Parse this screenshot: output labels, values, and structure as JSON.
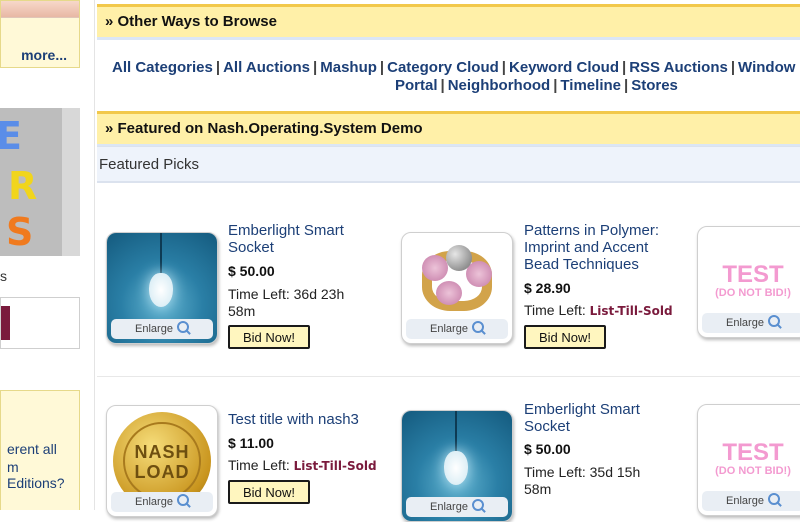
{
  "left": {
    "more_label": "more...",
    "banner_letters": [
      "E",
      "R",
      "S"
    ],
    "small_char": "s",
    "promo_lines": [
      "erent all",
      "m Editions?"
    ]
  },
  "sections": {
    "browse_title": "» Other Ways to Browse",
    "featured_title": "» Featured on Nash.Operating.System Demo",
    "picks_label": "Featured Picks"
  },
  "browse_links_row1": [
    "All Categories",
    "All Auctions",
    "Mashup",
    "Category Cloud",
    "Keyword Cloud",
    "RSS Auctions",
    "Window"
  ],
  "browse_links_row2": [
    "Portal",
    "Neighborhood",
    "Timeline",
    "Stores"
  ],
  "enlarge_label": "Enlarge",
  "bid_label": "Bid Now!",
  "time_left_label": "Time Left:",
  "listings": [
    {
      "title": "Emberlight Smart Socket",
      "price": "$ 50.00",
      "time": "36d 23h 58m"
    },
    {
      "title": "Patterns in Polymer: Imprint and Accent Bead Techniques",
      "price": "$ 28.90",
      "time": "List-Till-Sold"
    },
    {
      "title": "Test title with nash3",
      "price": "$ 11.00",
      "time": "List-Till-Sold"
    },
    {
      "title": "Emberlight Smart Socket",
      "price": "$ 50.00",
      "time": "35d 15h 58m"
    }
  ],
  "thumb_text": {
    "test": "TEST",
    "do_not_bid": "(DO NOT BID!)",
    "nash": "NASH",
    "load": "LOAD"
  },
  "colors": {
    "header_bg": "#fff0a8",
    "header_border": "#f2c84b",
    "link": "#1c3f77",
    "list_till_sold": "#7a1a3c",
    "bid_button_bg": "#fff6bf"
  }
}
